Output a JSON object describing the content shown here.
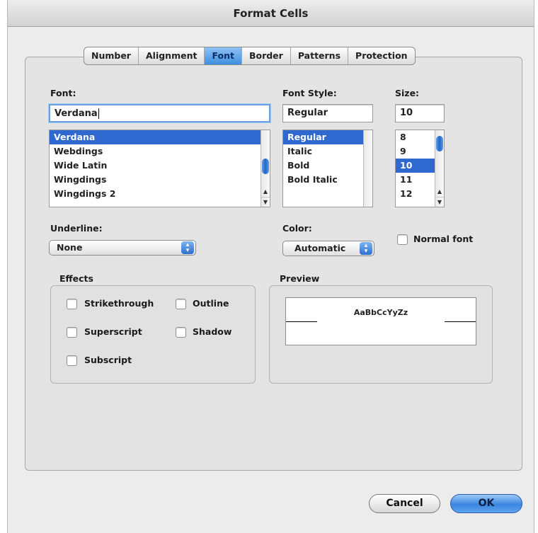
{
  "window": {
    "title": "Format Cells"
  },
  "tabs": [
    "Number",
    "Alignment",
    "Font",
    "Border",
    "Patterns",
    "Protection"
  ],
  "active_tab": "Font",
  "font": {
    "label": "Font:",
    "value": "Verdana",
    "items": [
      "Verdana",
      "Webdings",
      "Wide Latin",
      "Wingdings",
      "Wingdings 2"
    ],
    "selected": "Verdana"
  },
  "font_style": {
    "label": "Font Style:",
    "value": "Regular",
    "items": [
      "Regular",
      "Italic",
      "Bold",
      "Bold Italic"
    ],
    "selected": "Regular"
  },
  "size": {
    "label": "Size:",
    "value": "10",
    "items": [
      "8",
      "9",
      "10",
      "11",
      "12"
    ],
    "selected": "10"
  },
  "underline": {
    "label": "Underline:",
    "value": "None"
  },
  "color": {
    "label": "Color:",
    "value": "Automatic"
  },
  "normal_font": {
    "label": "Normal font",
    "checked": false
  },
  "effects": {
    "label": "Effects",
    "strikethrough": "Strikethrough",
    "superscript": "Superscript",
    "subscript": "Subscript",
    "outline": "Outline",
    "shadow": "Shadow"
  },
  "preview": {
    "label": "Preview",
    "sample": "AaBbCcYyZz"
  },
  "buttons": {
    "cancel": "Cancel",
    "ok": "OK"
  },
  "colors": {
    "accent": "#2f68cf",
    "tab_active": "#4a93e3",
    "ok_button": "#3b86e0"
  }
}
